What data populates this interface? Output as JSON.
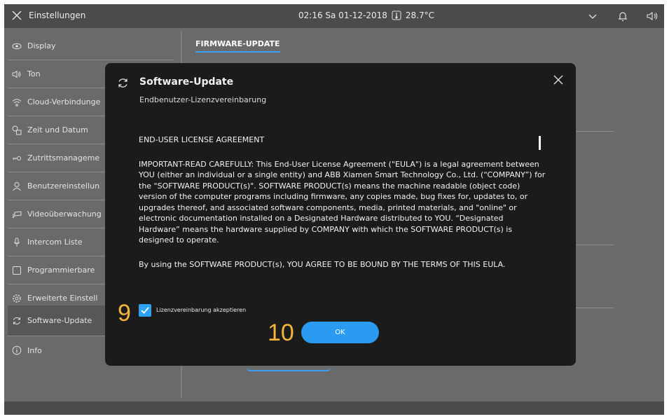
{
  "topbar": {
    "title": "Einstellungen",
    "status": "02:16  Sa 01-12-2018",
    "temperature": "28.7°C"
  },
  "sidebar": {
    "items": [
      {
        "label": "Display",
        "icon": "eye-icon"
      },
      {
        "label": "Ton",
        "icon": "speaker-icon"
      },
      {
        "label": "Cloud-Verbindunge",
        "icon": "wifi-icon"
      },
      {
        "label": "Zeit und Datum",
        "icon": "clock-calendar-icon"
      },
      {
        "label": "Zutrittsmanageme",
        "icon": "key-icon"
      },
      {
        "label": "Benutzereinstellun",
        "icon": "user-icon"
      },
      {
        "label": "Videoüberwachung",
        "icon": "camera-icon"
      },
      {
        "label": "Intercom Liste",
        "icon": "microphone-icon"
      },
      {
        "label": "Programmierbare",
        "icon": "square-icon"
      },
      {
        "label": "Erweiterte Einstell",
        "icon": "gear-icon"
      },
      {
        "label": "Software-Update",
        "icon": "refresh-icon",
        "active": true
      },
      {
        "label": "Info",
        "icon": "info-icon"
      }
    ]
  },
  "content": {
    "section_title": "FIRMWARE-UPDATE"
  },
  "modal": {
    "title": "Software-Update",
    "subtitle": "Endbenutzer-Lizenzvereinbarung",
    "eula": {
      "heading": "END-USER LICENSE AGREEMENT",
      "para1": "IMPORTANT-READ CAREFULLY: This End-User License Agreement (\"EULA\") is a legal agreement between YOU (either an individual or a single entity) and ABB Xiamen Smart Technology Co., Ltd. (“COMPANY”) for the \"SOFTWARE PRODUCT(s)\". SOFTWARE PRODUCT(s) means the machine readable (object code) version of the computer programs including firmware, any copies made, bug fixes for, updates to, or upgrades thereof, and associated software components, media, printed materials, and \"online\" or electronic documentation installed on a Designated Hardware distributed to YOU. “Designated Hardware” means the hardware supplied by COMPANY with which the SOFTWARE PRODUCT(s) is designed to operate.",
      "para2": "By using the SOFTWARE PRODUCT(s), YOU AGREE TO BE BOUND BY THE TERMS OF THIS EULA."
    },
    "checkbox_label": "Lizenzvereinbarung akzeptieren",
    "checkbox_checked": true,
    "ok_label": "OK"
  },
  "annotations": {
    "marker_9": "9",
    "marker_10": "10"
  },
  "colors": {
    "accent": "#2a9bf0",
    "marker": "#f4b43a",
    "modal_bg": "#1b1b1b",
    "screen_bg": "#6a6a6a"
  }
}
